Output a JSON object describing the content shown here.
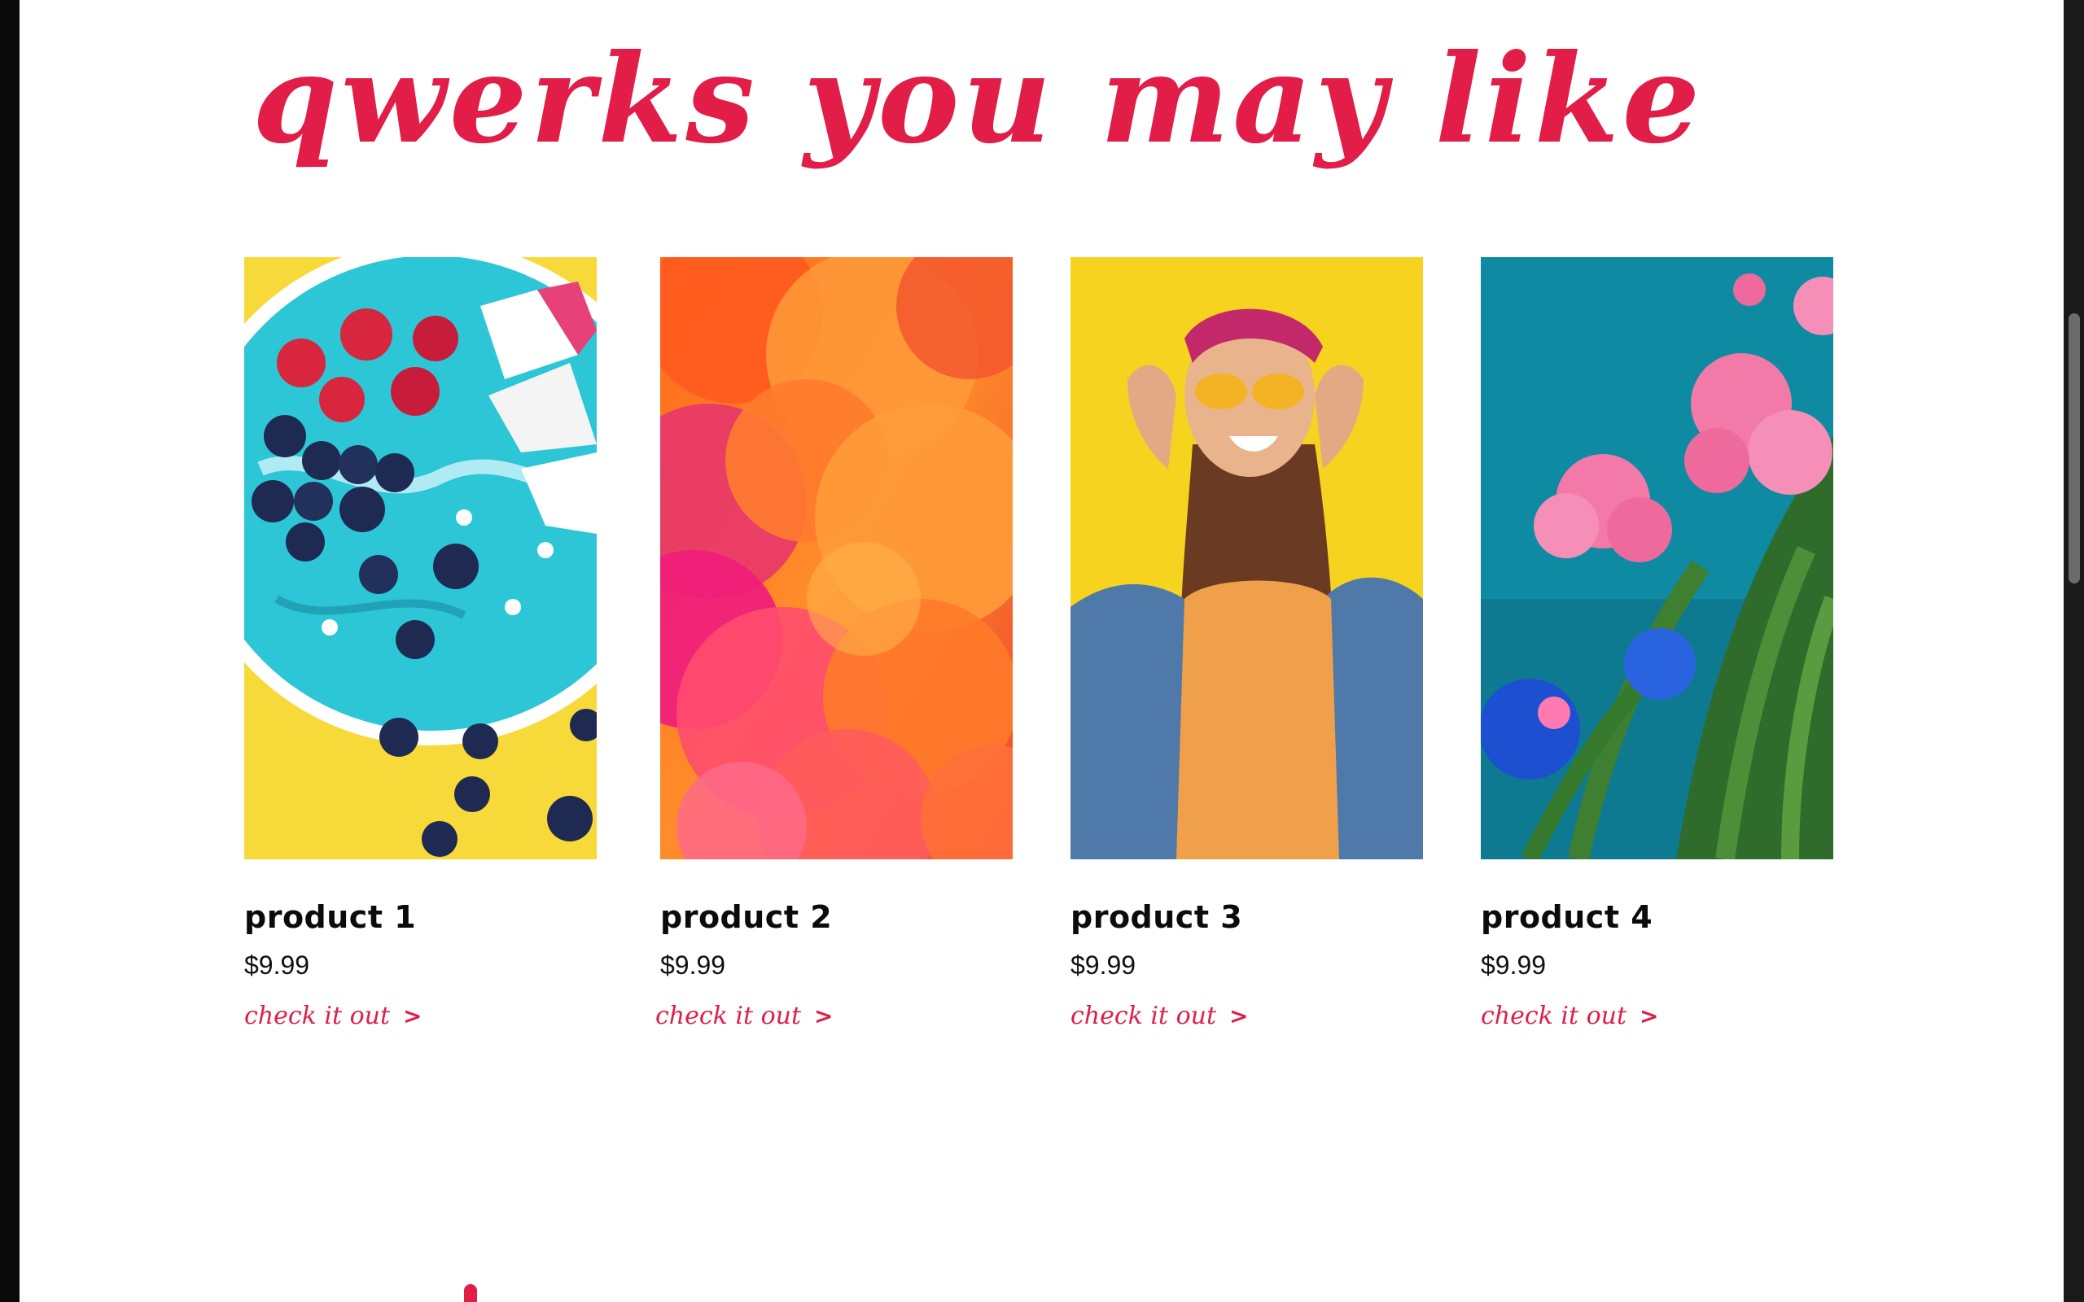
{
  "section": {
    "title": "qwerks you may like"
  },
  "products": [
    {
      "name": "product 1",
      "price": "$9.99",
      "link_label": "check it out",
      "image_icon": "smoothie-bowl-photo"
    },
    {
      "name": "product 2",
      "price": "$9.99",
      "link_label": "check it out",
      "image_icon": "colorful-smoke-photo"
    },
    {
      "name": "product 3",
      "price": "$9.99",
      "link_label": "check it out",
      "image_icon": "laughing-woman-photo"
    },
    {
      "name": "product 4",
      "price": "$9.99",
      "link_label": "check it out",
      "image_icon": "flowers-photo"
    }
  ],
  "link_arrow": ">",
  "colors": {
    "accent": "#e11d48",
    "text": "#0b0b0b",
    "background": "#ffffff",
    "frame": "#0e0e0e"
  }
}
